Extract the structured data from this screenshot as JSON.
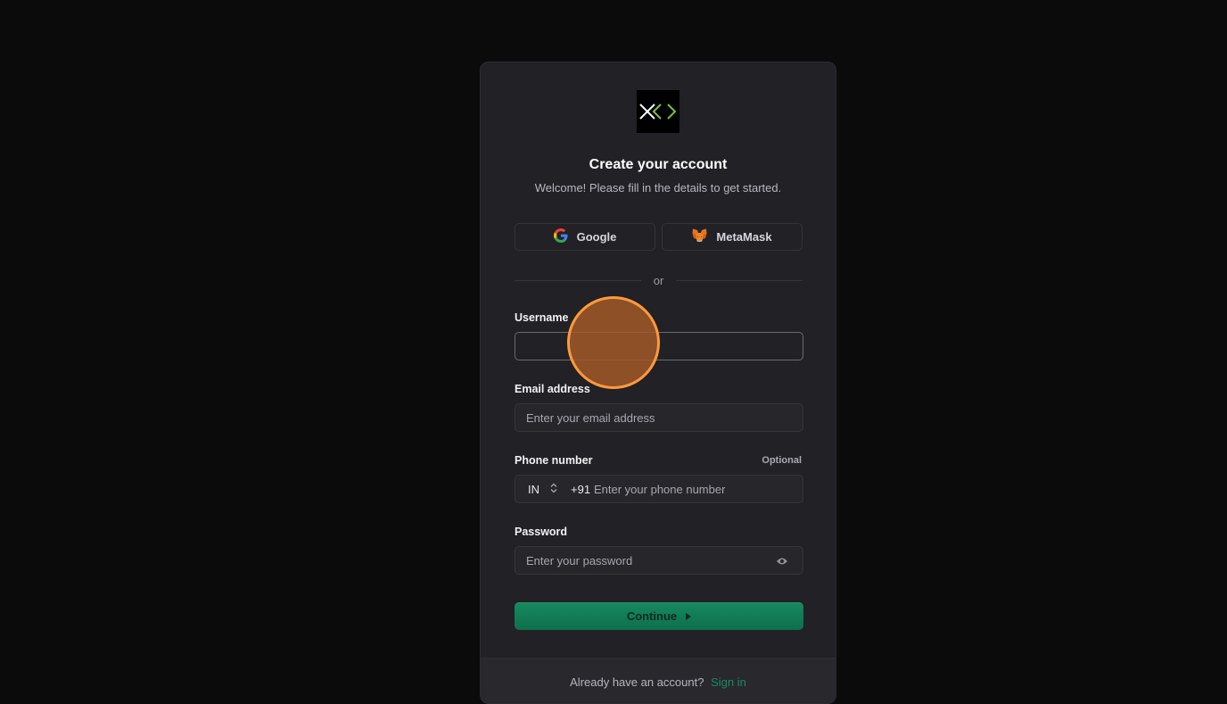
{
  "header": {
    "title": "Create your account",
    "subtitle": "Welcome! Please fill in the details to get started."
  },
  "social": {
    "google_label": "Google",
    "metamask_label": "MetaMask"
  },
  "divider_text": "or",
  "form": {
    "username": {
      "label": "Username",
      "value": "",
      "placeholder": ""
    },
    "email": {
      "label": "Email address",
      "value": "",
      "placeholder": "Enter your email address"
    },
    "phone": {
      "label": "Phone number",
      "optional_label": "Optional",
      "country": "IN",
      "dial_code": "+91",
      "value": "",
      "placeholder": "Enter your phone number"
    },
    "password": {
      "label": "Password",
      "value": "",
      "placeholder": "Enter your password"
    }
  },
  "continue_label": "Continue",
  "footer": {
    "text": "Already have an account?",
    "link": "Sign in"
  },
  "colors": {
    "accent": "#168a60",
    "card_bg": "#212126",
    "page_bg": "#0b0b0b",
    "cursor_marker": "#ff9a3c"
  },
  "icons": {
    "logo": "brand-logo",
    "google": "google-icon",
    "metamask": "metamask-fox-icon",
    "country_select": "chevron-up-down-icon",
    "password_toggle": "eye-icon",
    "continue": "caret-right-icon"
  }
}
